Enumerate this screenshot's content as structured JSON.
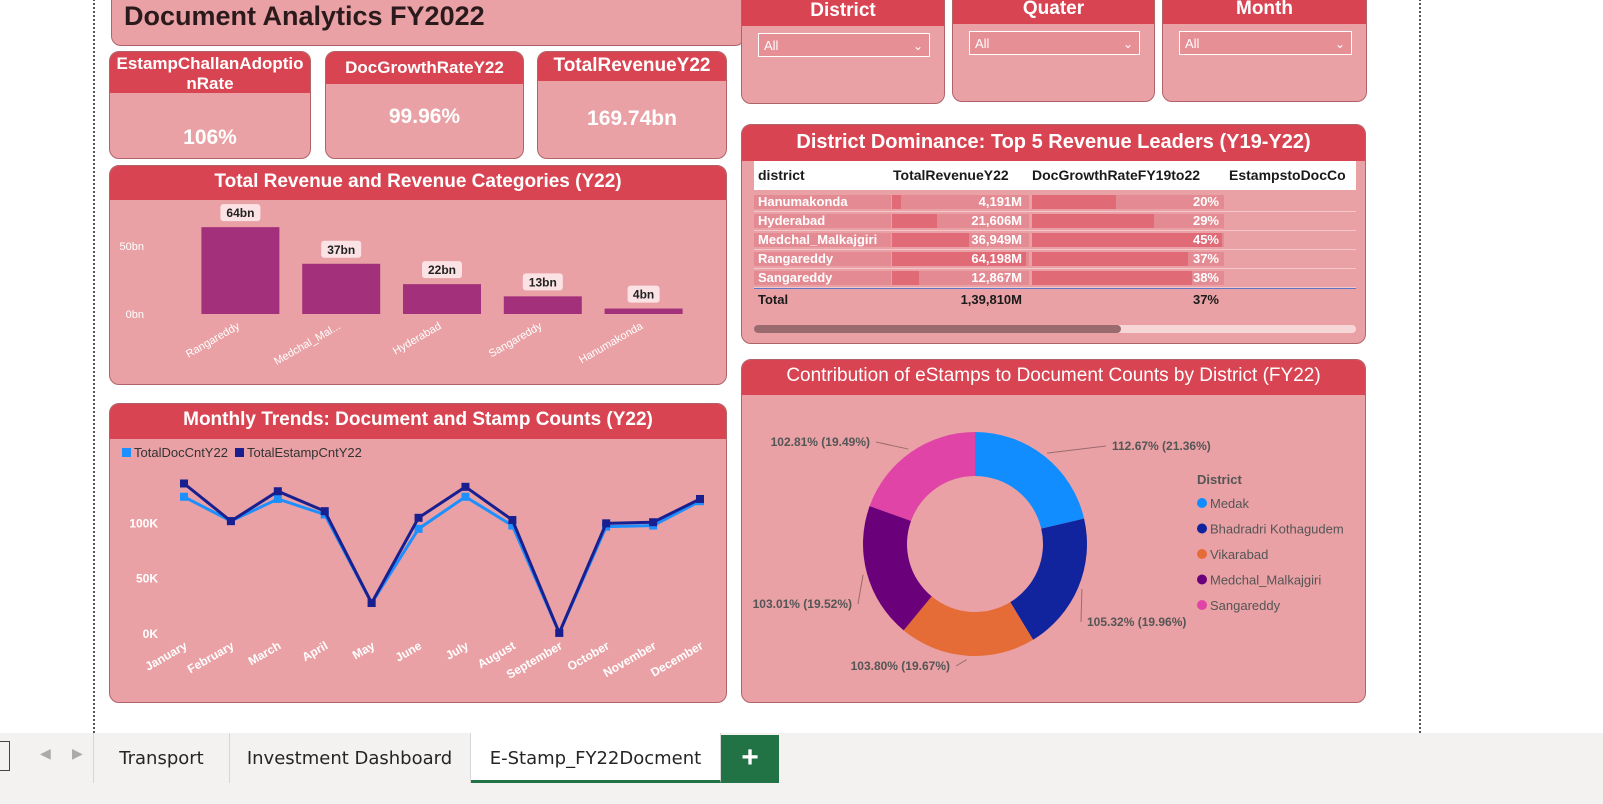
{
  "dashboard": {
    "title": "Document Analytics FY2022",
    "kpis": [
      {
        "label": "EstampChallanAdoptio nRate",
        "value": "106%"
      },
      {
        "label": "DocGrowthRateY22",
        "value": "99.96%"
      },
      {
        "label": "TotalRevenueY22",
        "value": "169.74bn"
      }
    ],
    "slicers": [
      {
        "label": "District",
        "value": "All"
      },
      {
        "label": "Quater",
        "value": "All"
      },
      {
        "label": "Month",
        "value": "All"
      }
    ],
    "revenue_chart_title": "Total Revenue and Revenue Categories (Y22)",
    "monthly_chart_title": "Monthly Trends: Document and Stamp Counts (Y22)",
    "table_title": "District Dominance: Top 5 Revenue Leaders (Y19-Y22)",
    "donut_title": "Contribution of eStamps to Document Counts by District (FY22)"
  },
  "table": {
    "columns": [
      "district",
      "TotalRevenueY22",
      "DocGrowthRateFY19to22",
      "EstampstoDocCo"
    ],
    "rows": [
      {
        "district": "Hanumakonda",
        "revenue": "4,191M",
        "growth": "20%",
        "rev_frac": 0.065,
        "growth_frac": 0.44
      },
      {
        "district": "Hyderabad",
        "revenue": "21,606M",
        "growth": "29%",
        "rev_frac": 0.337,
        "growth_frac": 0.64
      },
      {
        "district": "Medchal_Malkajgiri",
        "revenue": "36,949M",
        "growth": "45%",
        "rev_frac": 0.576,
        "growth_frac": 1.0
      },
      {
        "district": "Rangareddy",
        "revenue": "64,198M",
        "growth": "37%",
        "rev_frac": 1.0,
        "growth_frac": 0.82
      },
      {
        "district": "Sangareddy",
        "revenue": "12,867M",
        "growth": "38%",
        "rev_frac": 0.2,
        "growth_frac": 0.84
      }
    ],
    "total": {
      "label": "Total",
      "revenue": "1,39,810M",
      "growth": "37%"
    }
  },
  "chart_data": [
    {
      "type": "bar",
      "title": "Total Revenue and Revenue Categories (Y22)",
      "categories": [
        "Rangareddy",
        "Medchal_Mal...",
        "Hyderabad",
        "Sangareddy",
        "Hanumakonda"
      ],
      "values": [
        64,
        37,
        22,
        13,
        4
      ],
      "data_labels": [
        "64bn",
        "37bn",
        "22bn",
        "13bn",
        "4bn"
      ],
      "yticks": [
        "0bn",
        "50bn"
      ],
      "ylim": [
        0,
        70
      ],
      "color": "#a3307a"
    },
    {
      "type": "line",
      "title": "Monthly Trends: Document and Stamp Counts (Y22)",
      "x": [
        "January",
        "February",
        "March",
        "April",
        "May",
        "June",
        "July",
        "August",
        "September",
        "October",
        "November",
        "December"
      ],
      "series": [
        {
          "name": "TotalDocCntY22",
          "color": "#1e8fff",
          "values": [
            124000,
            102000,
            122000,
            108000,
            28000,
            95000,
            124000,
            98000,
            1000,
            97000,
            98000,
            120000
          ]
        },
        {
          "name": "TotalEstampCntY22",
          "color": "#1a1f8f",
          "values": [
            136000,
            102000,
            129000,
            111000,
            28000,
            105000,
            133000,
            103000,
            1000,
            100000,
            101000,
            122000
          ]
        }
      ],
      "yticks": [
        "0K",
        "50K",
        "100K"
      ],
      "ylim": [
        0,
        150000
      ],
      "legend": "top-left"
    },
    {
      "type": "pie",
      "title": "Contribution of eStamps to Document Counts by District (FY22)",
      "legend_title": "District",
      "slices": [
        {
          "name": "Medak",
          "label": "112.67% (21.36%)",
          "share": 21.36,
          "color": "#118dff"
        },
        {
          "name": "Bhadradri Kothagudem",
          "label": "105.32% (19.96%)",
          "share": 19.96,
          "color": "#12239e"
        },
        {
          "name": "Vikarabad",
          "label": "103.80% (19.67%)",
          "share": 19.67,
          "color": "#e66c37"
        },
        {
          "name": "Medchal_Malkajgiri",
          "label": "103.01% (19.52%)",
          "share": 19.52,
          "color": "#6b007b"
        },
        {
          "name": "Sangareddy",
          "label": "102.81% (19.49%)",
          "share": 19.49,
          "color": "#e044a7"
        }
      ]
    }
  ],
  "sheet_tabs": {
    "items": [
      "Transport",
      "Investment Dashboard",
      "E-Stamp_FY22Docment"
    ],
    "active": "E-Stamp_FY22Docment",
    "add_label": "+"
  }
}
